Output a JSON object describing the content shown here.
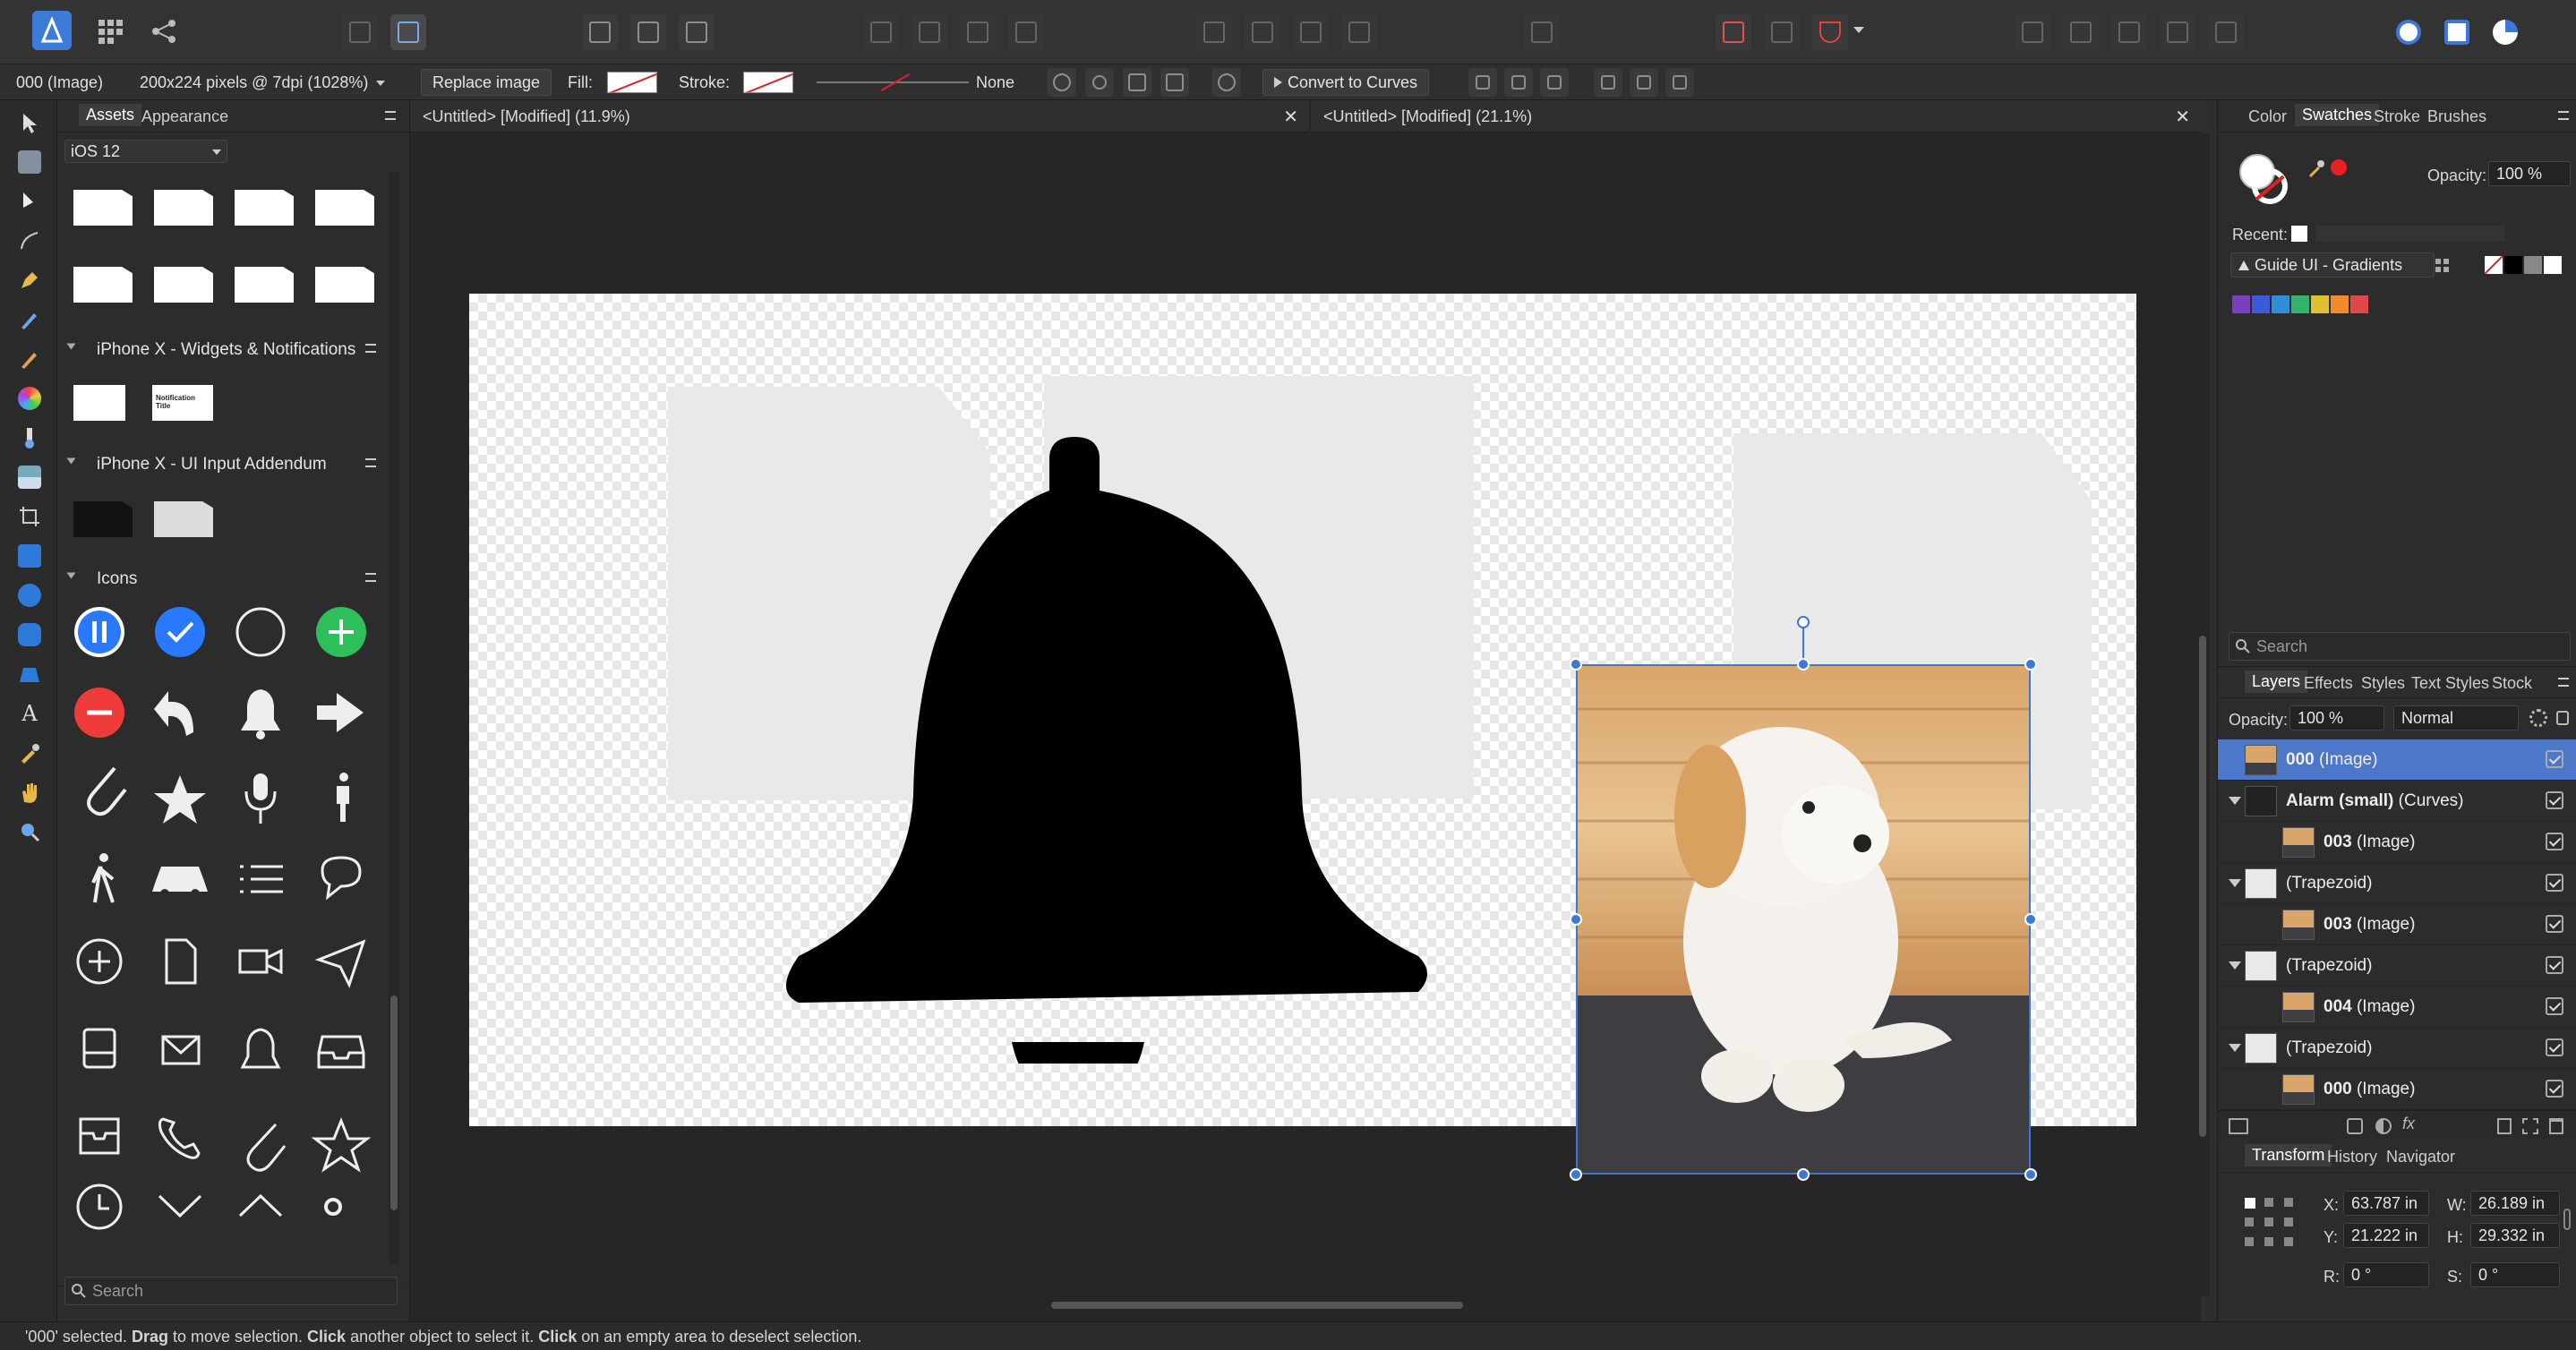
{
  "context_bar": {
    "selection": "000 (Image)",
    "pixels_info": "200x224 pixels @ 7dpi (1028%)",
    "replace_image": "Replace image",
    "fill_label": "Fill:",
    "stroke_label": "Stroke:",
    "stroke_value": "None",
    "convert_to_curves": "Convert to Curves"
  },
  "assets_panel": {
    "tabs": [
      "Assets",
      "Appearance"
    ],
    "category": "iOS 12",
    "sections": [
      "iPhone X - Widgets & Notifications",
      "iPhone X - UI Input Addendum",
      "Icons"
    ],
    "notification_title": "Notification Title",
    "search_placeholder": "Search"
  },
  "documents": {
    "tab1": "<Untitled> [Modified] (11.9%)",
    "tab2": "<Untitled> [Modified] (21.1%)"
  },
  "swatches_panel": {
    "tabs": [
      "Color",
      "Swatches",
      "Stroke",
      "Brushes"
    ],
    "opacity_label": "Opacity:",
    "opacity_value": "100 %",
    "recent_label": "Recent:",
    "palette": "Guide UI - Gradients",
    "search_placeholder": "Search",
    "palette_colors": [
      "#7a3fbf",
      "#3a5ad8",
      "#2f8fd6",
      "#36b36a",
      "#e0c030",
      "#f08a2a",
      "#e04848"
    ]
  },
  "layers_panel": {
    "tabs": [
      "Layers",
      "Effects",
      "Styles",
      "Text Styles",
      "Stock"
    ],
    "opacity_label": "Opacity:",
    "opacity_value": "100 %",
    "blend_mode": "Normal",
    "rows": [
      {
        "name": "000",
        "type": "(Image)",
        "indent": 0,
        "selected": true,
        "expand": false
      },
      {
        "name": "Alarm (small)",
        "type": "(Curves)",
        "indent": 0,
        "selected": false,
        "expand": true
      },
      {
        "name": "003",
        "type": "(Image)",
        "indent": 1,
        "selected": false,
        "expand": false
      },
      {
        "name": "",
        "type": "(Trapezoid)",
        "indent": 0,
        "selected": false,
        "expand": true
      },
      {
        "name": "003",
        "type": "(Image)",
        "indent": 1,
        "selected": false,
        "expand": false
      },
      {
        "name": "",
        "type": "(Trapezoid)",
        "indent": 0,
        "selected": false,
        "expand": true
      },
      {
        "name": "004",
        "type": "(Image)",
        "indent": 1,
        "selected": false,
        "expand": false
      },
      {
        "name": "",
        "type": "(Trapezoid)",
        "indent": 0,
        "selected": false,
        "expand": true
      },
      {
        "name": "000",
        "type": "(Image)",
        "indent": 1,
        "selected": false,
        "expand": false
      }
    ]
  },
  "transform_panel": {
    "tabs": [
      "Transform",
      "History",
      "Navigator"
    ],
    "x_label": "X:",
    "x": "63.787 in",
    "y_label": "Y:",
    "y": "21.222 in",
    "w_label": "W:",
    "w": "26.189 in",
    "h_label": "H:",
    "h": "29.332 in",
    "r_label": "R:",
    "r": "0 °",
    "s_label": "S:",
    "s": "0 °"
  },
  "status": {
    "part1": "'000' selected. ",
    "drag": "Drag",
    "part2": " to move selection. ",
    "click1": "Click",
    "part3": " another object to select it. ",
    "click2": "Click",
    "part4": " on an empty area to deselect selection."
  }
}
